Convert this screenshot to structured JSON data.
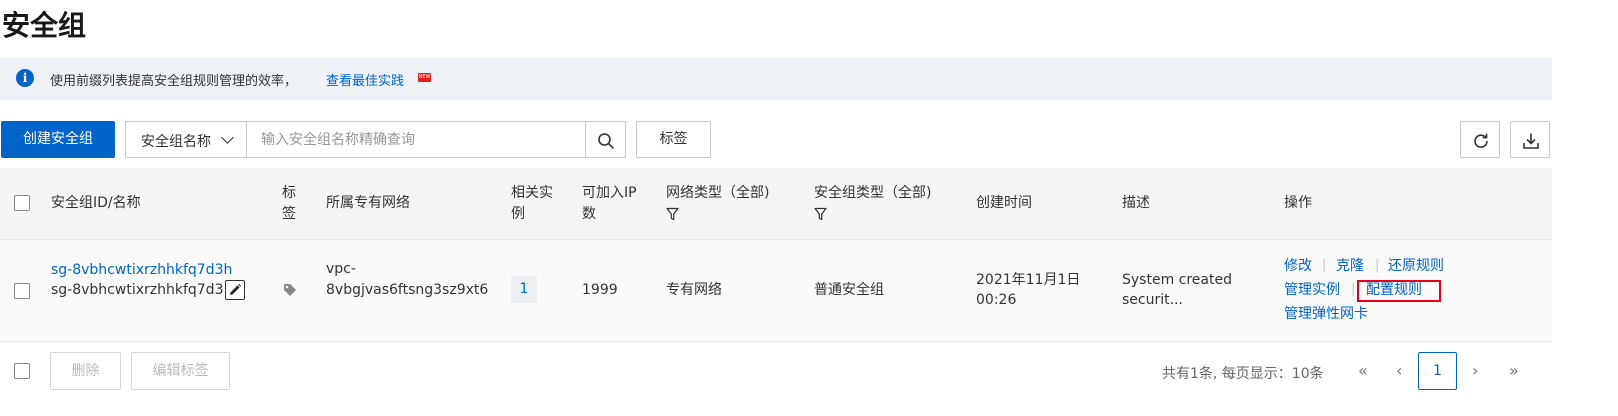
{
  "page": {
    "title": "安全组"
  },
  "notice": {
    "message": "使用前缀列表提高安全组规则管理的效率，",
    "link": "查看最佳实践",
    "badge": "NEW"
  },
  "toolbar": {
    "create_label": "创建安全组",
    "filter_select": "安全组名称",
    "search_placeholder": "输入安全组名称精确查询",
    "tag_button": "标签"
  },
  "table": {
    "headers": {
      "id_name": "安全组ID/名称",
      "tag": "标签",
      "vpc": "所属专有网络",
      "related": "相关实例",
      "joinable_ip": "可加入IP数",
      "network_type": "网络类型（全部)",
      "sg_type": "安全组类型（全部)",
      "created": "创建时间",
      "description": "描述",
      "actions": "操作"
    },
    "rows": [
      {
        "id": "sg-8vbhcwtixrzhhkfq7d3h",
        "name": "sg-8vbhcwtixrzhhkfq7d3...",
        "vpc_line1": "vpc-",
        "vpc_line2": "8vbgjvas6ftsng3sz9xt6",
        "related": "1",
        "joinable_ip": "1999",
        "network_type": "专有网络",
        "sg_type": "普通安全组",
        "created_line1": "2021年11月1日",
        "created_line2": "00:26",
        "desc_line1": "System created",
        "desc_line2": "securit...",
        "actions": {
          "modify": "修改",
          "clone": "克隆",
          "restore": "还原规则",
          "manage_instances": "管理实例",
          "configure_rules": "配置规则",
          "manage_eni": "管理弹性网卡"
        }
      }
    ]
  },
  "footer": {
    "delete": "删除",
    "edit_tags": "编辑标签",
    "total_text": "共有1条, 每页显示：10条",
    "current_page": "1"
  },
  "colors": {
    "primary": "#0064c8",
    "highlight": "#e3001b",
    "notice_bg": "#eef2f7"
  }
}
